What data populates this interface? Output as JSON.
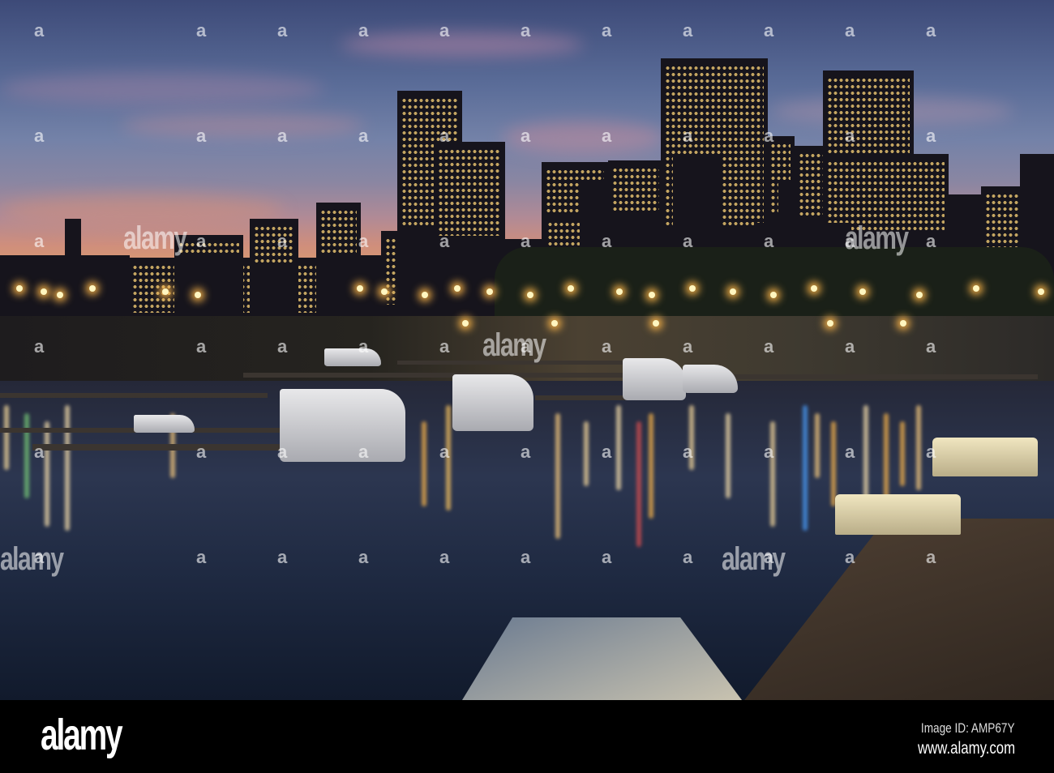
{
  "watermark": {
    "text": "alamy",
    "icon": "a"
  },
  "footer": {
    "logo": "alamy",
    "image_id": "Image ID: AMP67Y",
    "website": "www.alamy.com"
  },
  "colors": {
    "sky_top": "#3d4a78",
    "horizon": "#d99a70",
    "water": "#1f2a42",
    "light": "#ffb84a"
  }
}
